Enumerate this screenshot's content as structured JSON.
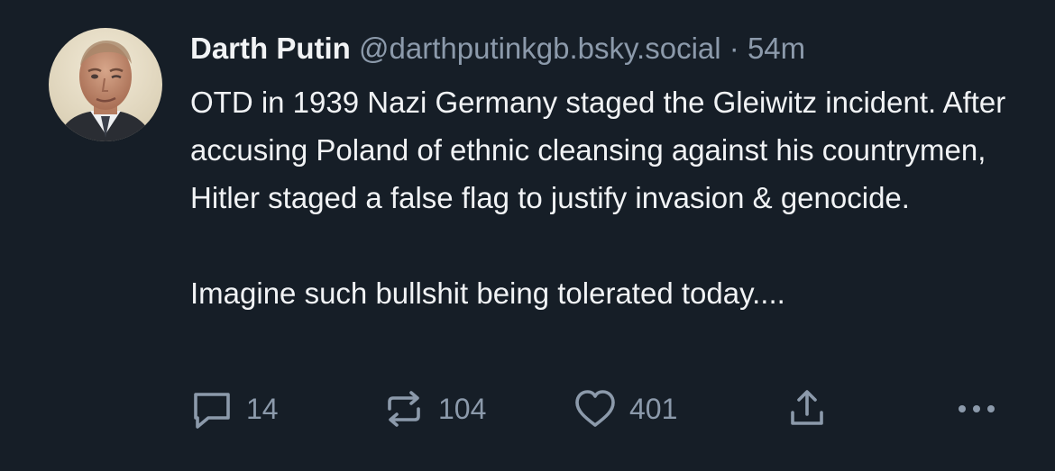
{
  "post": {
    "author": {
      "display_name": "Darth Putin",
      "handle": "@darthputinkgb.bsky.social",
      "avatar_icon": "avatar-photo"
    },
    "separator": "·",
    "time_ago": "54m",
    "text": {
      "paragraph_1": "OTD in 1939 Nazi Germany staged the Gleiwitz incident. After accusing Poland of ethnic cleansing against his countrymen, Hitler staged a false flag to justify invasion & genocide.",
      "paragraph_2": "Imagine such bullshit being tolerated today...."
    },
    "actions": {
      "reply_count": "14",
      "repost_count": "104",
      "like_count": "401"
    }
  },
  "colors": {
    "background": "#161e27",
    "text": "#f1f3f5",
    "muted": "#8c9aab"
  },
  "icons": [
    "reply-icon",
    "repost-icon",
    "like-icon",
    "share-icon",
    "more-icon"
  ]
}
